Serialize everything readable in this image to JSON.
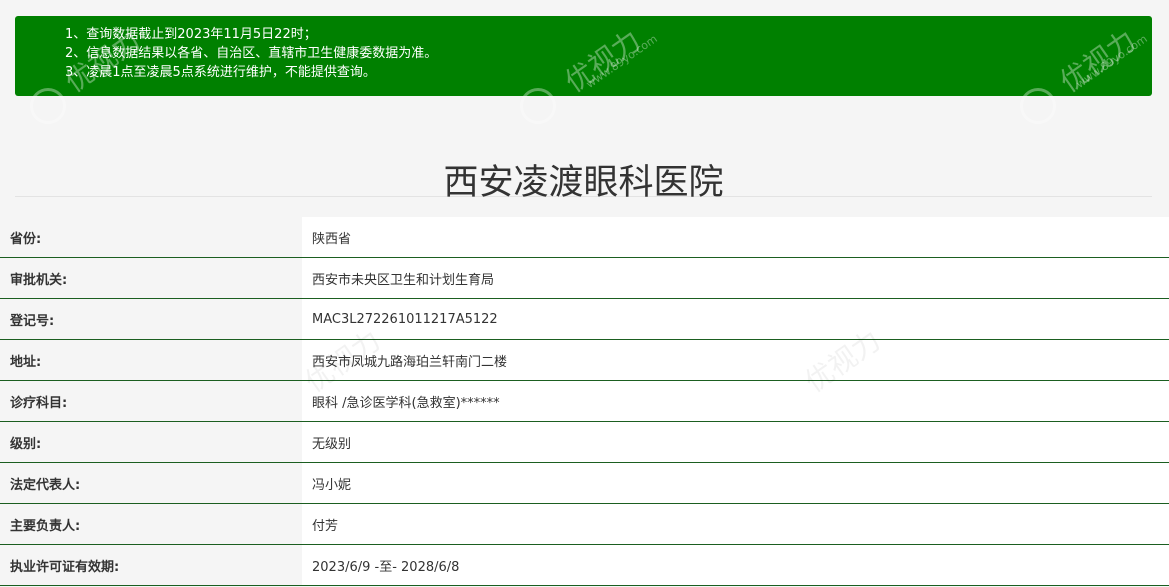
{
  "notice": {
    "lines": [
      "1、查询数据截止到2023年11月5日22时；",
      "2、信息数据结果以各省、自治区、直辖市卫生健康委数据为准。",
      "3、凌晨1点至凌晨5点系统进行维护，不能提供查询。"
    ]
  },
  "hospital": {
    "name": "西安凌渡眼科医院"
  },
  "rows": [
    {
      "label": "省份:",
      "value": "陕西省"
    },
    {
      "label": "审批机关:",
      "value": "西安市未央区卫生和计划生育局"
    },
    {
      "label": "登记号:",
      "value": "MAC3L272261011217A5122"
    },
    {
      "label": "地址:",
      "value": "西安市凤城九路海珀兰轩南门二楼"
    },
    {
      "label": "诊疗科目:",
      "value": "眼科 /急诊医学科(急救室)******"
    },
    {
      "label": "级别:",
      "value": "无级别"
    },
    {
      "label": "法定代表人:",
      "value": "冯小妮"
    },
    {
      "label": "主要负责人:",
      "value": "付芳"
    },
    {
      "label": "执业许可证有效期:",
      "value": "2023/6/9 -至- 2028/6/8"
    }
  ],
  "watermark": {
    "text": "优视力",
    "url": "www.89yo.com"
  },
  "colors": {
    "notice_bg": "#008000",
    "row_border": "#1b5e20"
  }
}
